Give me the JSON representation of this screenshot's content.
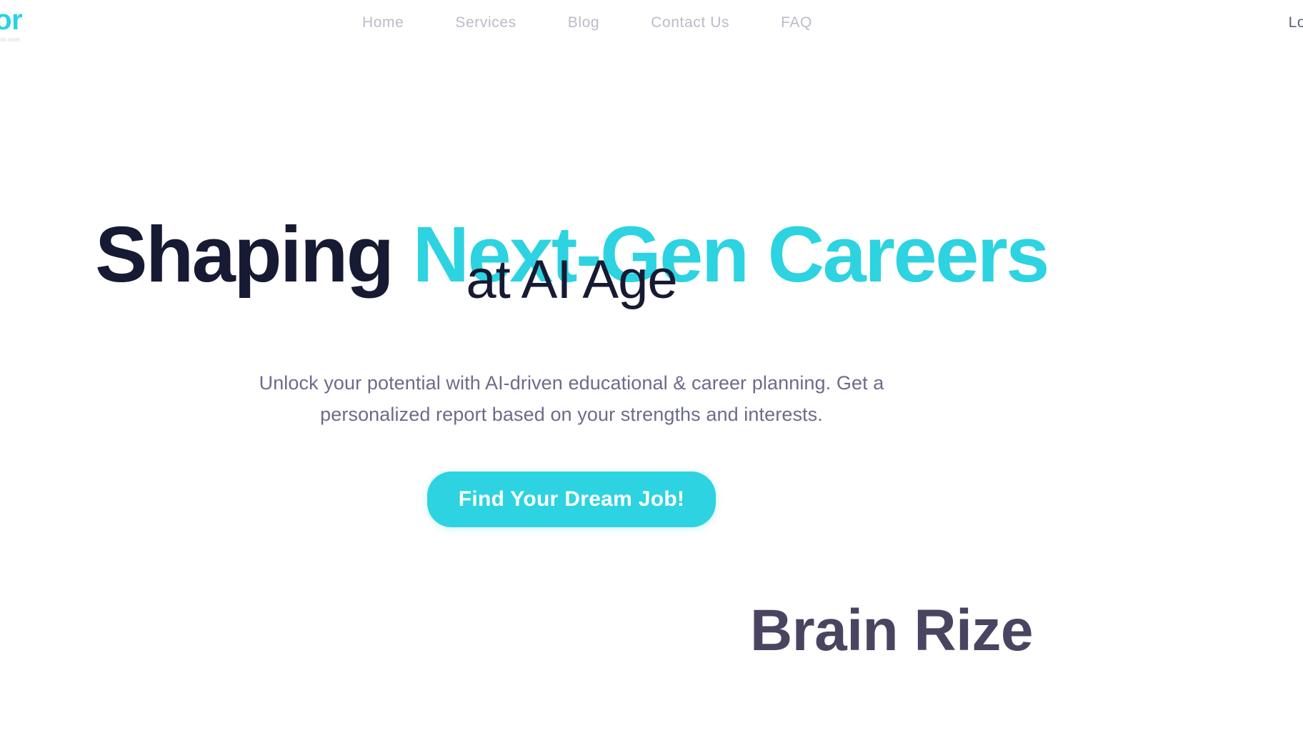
{
  "colors": {
    "accent": "#2DD3E0",
    "headline_dark": "#171A33",
    "body_text": "#6B6C8A",
    "nav_text": "#B9BCC9",
    "wordmark": "#4A4460",
    "background": "#FFFFFF"
  },
  "header": {
    "logo": {
      "text": "Xor",
      "tagline": "Eduxor.com"
    },
    "nav": [
      {
        "label": "Home"
      },
      {
        "label": "Services"
      },
      {
        "label": "Blog"
      },
      {
        "label": "Contact Us"
      },
      {
        "label": "FAQ"
      }
    ],
    "auth": {
      "login_label": "Login"
    }
  },
  "hero": {
    "headline_part1": "Shaping ",
    "headline_part2": "Next-Gen Careers",
    "headline_line2": "at AI Age",
    "lede": "Unlock your potential with AI-driven educational & career planning. Get a personalized report based on your strengths and interests.",
    "cta_label": "Find Your Dream Job!"
  },
  "footer_wordmark": {
    "text": "Brain Rize"
  }
}
